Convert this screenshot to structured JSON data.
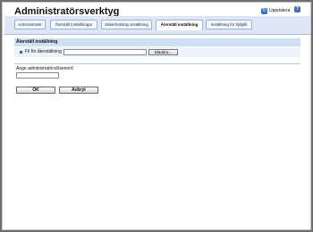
{
  "header": {
    "title": "Administratörsverktyg",
    "update_label": "Uppdatera",
    "update_icon": "refresh-icon",
    "help_icon": "help-icon"
  },
  "tabs": [
    {
      "label": "Administratör",
      "active": false
    },
    {
      "label": "Återställ inställningar",
      "active": false
    },
    {
      "label": "Säkerhetskop.inställning",
      "active": false
    },
    {
      "label": "Återställ inställning",
      "active": true
    },
    {
      "label": "Inställning för hjälpfil",
      "active": false
    }
  ],
  "section": {
    "title": "Återställ inställning",
    "file_label": "Fil för återställning",
    "file_value": "",
    "browse_label": "Bläddra..."
  },
  "password": {
    "label": "Ange administratörslösenord",
    "value": ""
  },
  "actions": {
    "ok_label": "OK",
    "cancel_label": "Avbryt"
  }
}
